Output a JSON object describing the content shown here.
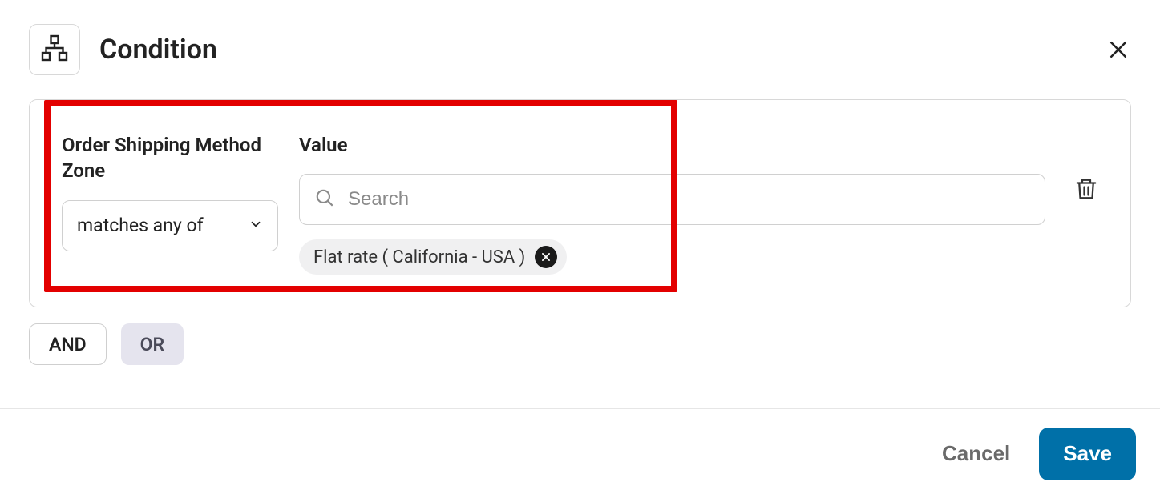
{
  "header": {
    "title": "Condition"
  },
  "condition": {
    "field_label": "Order Shipping Method Zone",
    "operator_selected": "matches any of",
    "value_label": "Value",
    "search_placeholder": "Search",
    "chips": [
      {
        "label": "Flat rate ( California - USA )"
      }
    ]
  },
  "logic": {
    "and_label": "AND",
    "or_label": "OR"
  },
  "footer": {
    "cancel_label": "Cancel",
    "save_label": "Save"
  }
}
